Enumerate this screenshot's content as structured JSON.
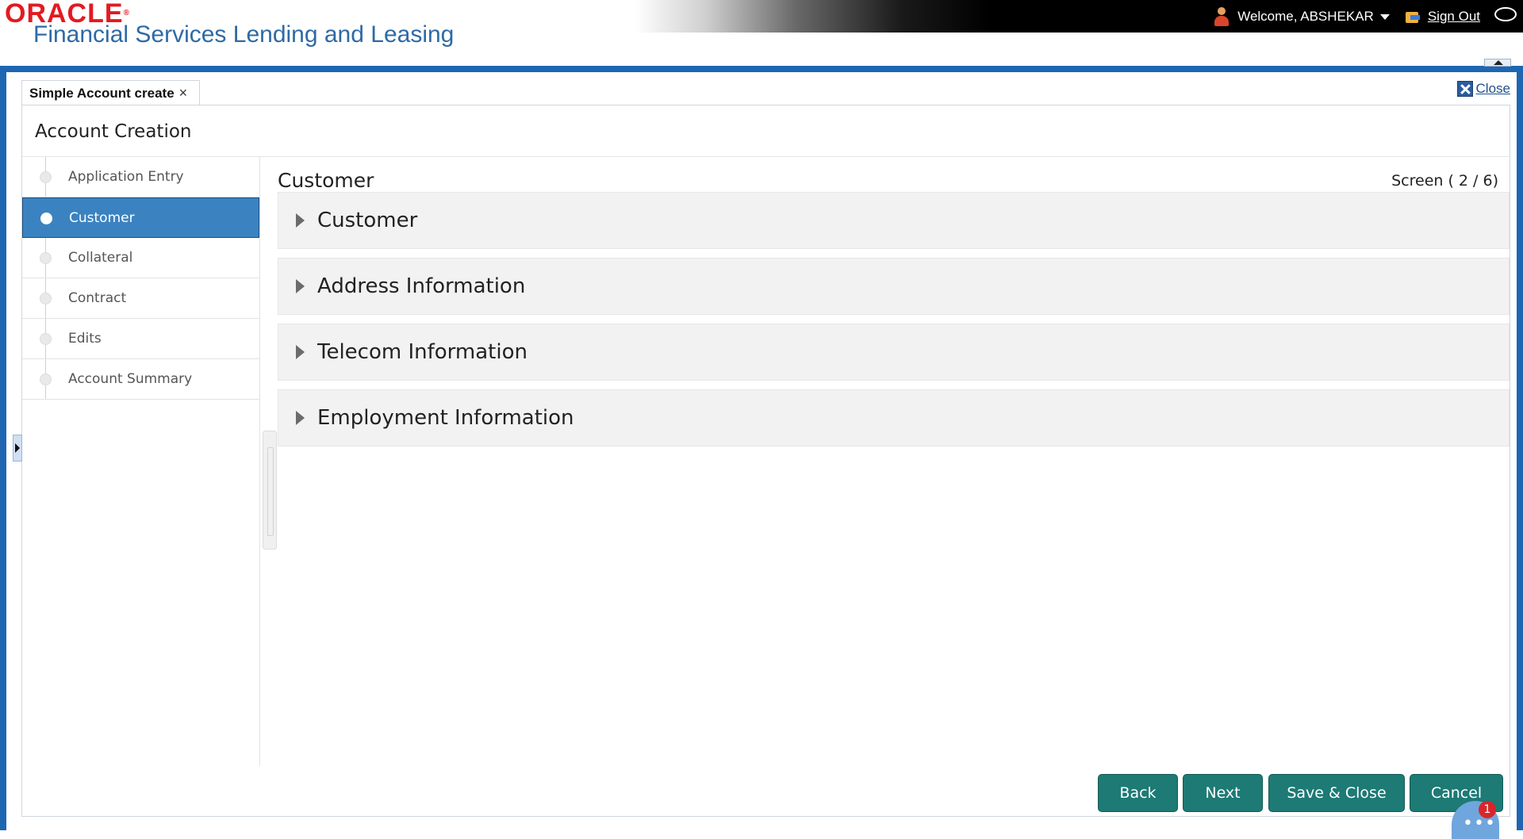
{
  "brand": {
    "oracle": "ORACLE",
    "product": "Financial Services Lending and Leasing"
  },
  "user": {
    "welcome": "Welcome, ABSHEKAR",
    "signout": "Sign Out"
  },
  "tab": {
    "label": "Simple Account create",
    "close_glyph": "×"
  },
  "close_label": "Close",
  "page_title": "Account Creation",
  "train": [
    {
      "label": "Application Entry",
      "active": false
    },
    {
      "label": "Customer",
      "active": true
    },
    {
      "label": "Collateral",
      "active": false
    },
    {
      "label": "Contract",
      "active": false
    },
    {
      "label": "Edits",
      "active": false
    },
    {
      "label": "Account Summary",
      "active": false
    }
  ],
  "main": {
    "section_title": "Customer",
    "screen_counter": "Screen ( 2 / 6)",
    "accordions": [
      {
        "label": "Customer"
      },
      {
        "label": "Address Information"
      },
      {
        "label": "Telecom Information"
      },
      {
        "label": "Employment Information"
      }
    ]
  },
  "buttons": {
    "back": "Back",
    "next": "Next",
    "save_close": "Save & Close",
    "cancel": "Cancel"
  },
  "chat": {
    "badge": "1"
  },
  "colors": {
    "frame_blue": "#1f66b2",
    "active_train": "#3b83c0",
    "button_teal": "#1d7a75",
    "oracle_red": "#e21a22"
  }
}
